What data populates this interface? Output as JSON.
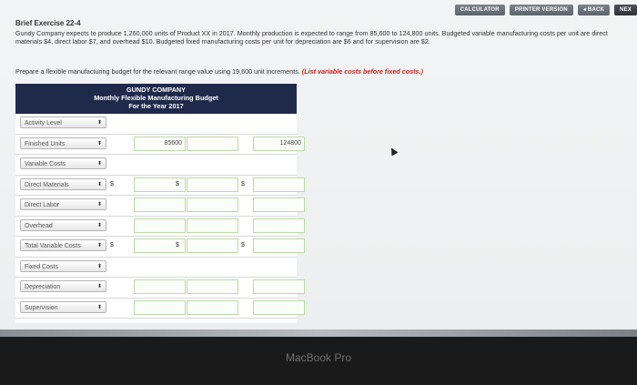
{
  "toolbar": {
    "calculator": "CALCULATOR",
    "printer": "PRINTER VERSION",
    "back": "◂ BACK",
    "next": "NEX"
  },
  "exercise": {
    "title": "Brief Exercise 22-4",
    "paragraph": "Gundy Company expects to produce 1,260,000 units of Product XX in 2017. Monthly production is expected to range from 85,600 to 124,800 units. Budgeted variable manufacturing costs per unit are direct materials $4, direct labor $7, and overhead $10. Budgeted fixed manufacturing costs per unit for depreciation are $6 and for supervision are $2.",
    "prompt": "Prepare a flexible manufacturing budget for the relevant range value using 19,600 unit increments.",
    "instruction": "(List variable costs before fixed costs.)"
  },
  "budget": {
    "company": "GUNDY COMPANY",
    "name": "Monthly Flexible Manufacturing Budget",
    "period": "For the Year 2017",
    "rows": [
      {
        "label": "Activity Level",
        "inputs": false
      },
      {
        "label": "Finished Units",
        "inputs": true,
        "values": [
          "85600",
          "",
          "124800"
        ],
        "dollar": false
      },
      {
        "label": "Variable Costs",
        "inputs": false
      },
      {
        "label": "Direct Materials",
        "inputs": true,
        "values": [
          "",
          "",
          ""
        ],
        "dollar": true
      },
      {
        "label": "Direct Labor",
        "inputs": true,
        "values": [
          "",
          "",
          ""
        ],
        "dollar": false
      },
      {
        "label": "Overhead",
        "inputs": true,
        "values": [
          "",
          "",
          ""
        ],
        "dollar": false
      },
      {
        "label": "Total Variable Costs",
        "inputs": true,
        "values": [
          "",
          "",
          ""
        ],
        "dollar": true
      },
      {
        "label": "Fixed Costs",
        "inputs": false
      },
      {
        "label": "Depreciation",
        "inputs": true,
        "values": [
          "",
          "",
          ""
        ],
        "dollar": false
      },
      {
        "label": "Supervision",
        "inputs": true,
        "values": [
          "",
          "",
          ""
        ],
        "dollar": false
      }
    ],
    "dollar_sign": "$",
    "select_arrow": "⬍"
  },
  "device": {
    "brand": "MacBook Pro"
  }
}
